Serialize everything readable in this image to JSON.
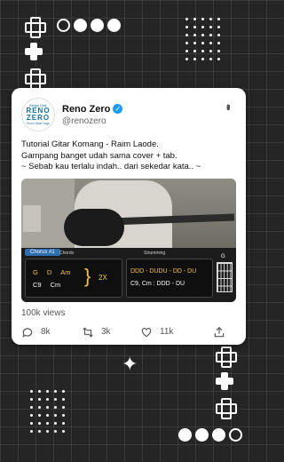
{
  "tweet": {
    "author_name": "Reno Zero",
    "author_handle": "@renozero",
    "avatar": {
      "top_text": "Belajar Gitar",
      "line1": "RENO",
      "line2": "ZERO",
      "bottom_text": "Kunci Gitar Lagu"
    },
    "text_lines": [
      "Tutorial Gitar Komang - Raim Laode.",
      "Gampang banget udah sama cover + tab.",
      "~ Sebab kau terlalu indah.. dari sekedar kata.. ~"
    ],
    "views": "100k views",
    "actions": {
      "replies": "8k",
      "retweets": "3k",
      "likes": "11k"
    }
  },
  "media": {
    "section_tag": "Chorus #1",
    "chords_label": "Chords",
    "strumming_label": "Strumming",
    "chords_row1": [
      "G",
      "D",
      "Am"
    ],
    "chords_row2": [
      "C9",
      "Cm"
    ],
    "repeat": "2X",
    "strum_pattern": "DDD - DUDU - DD - DU",
    "strum_chords": "C9, Cm : DDD - DU",
    "chord_diagram_name": "G"
  },
  "colors": {
    "background": "#252525",
    "card": "#ffffff",
    "verified": "#1d9bf0",
    "chord_accent": "#f6c34a"
  }
}
